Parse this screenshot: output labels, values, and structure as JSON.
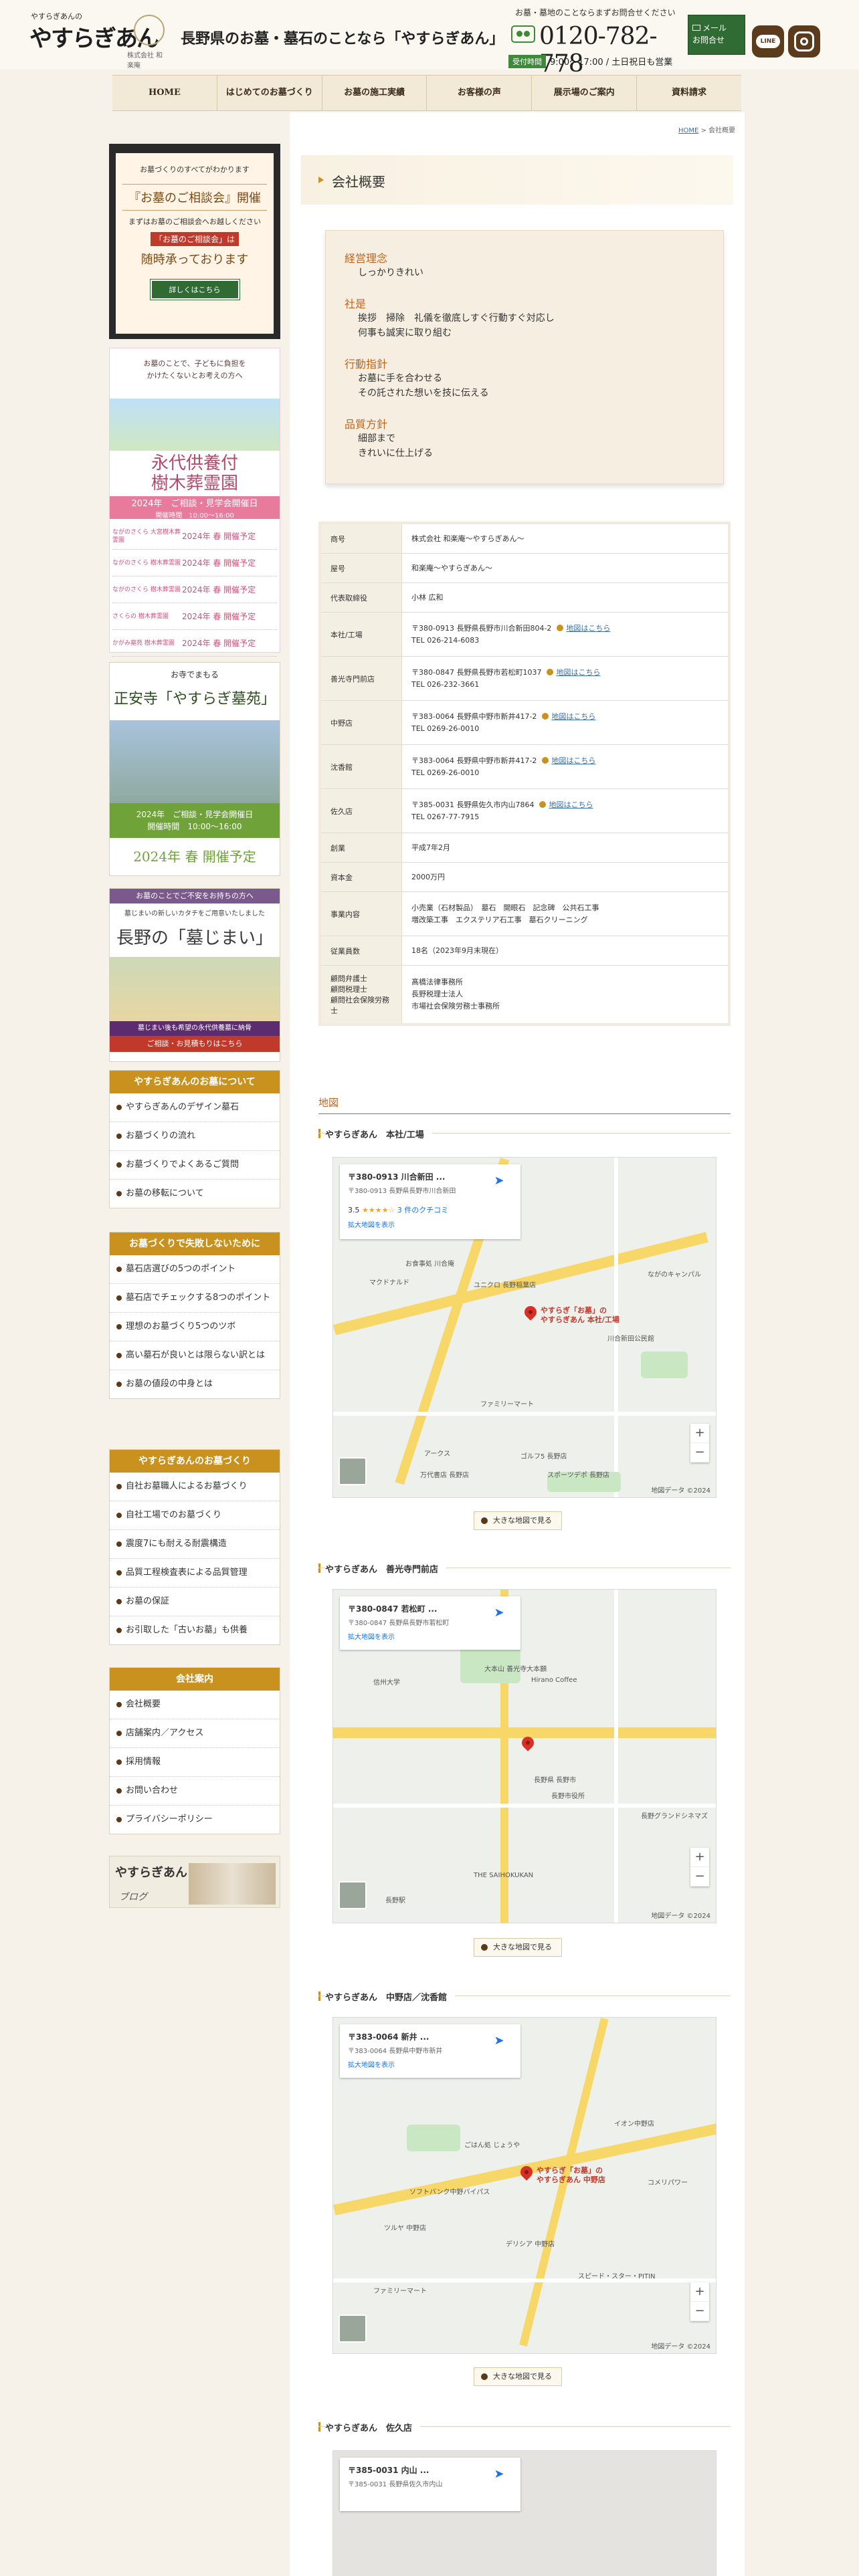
{
  "header": {
    "logo_small": "やすらぎあんの",
    "logo_main": "やすらぎあん",
    "logo_sub": "株式会社 和楽庵",
    "tagline": "長野県のお墓・墓石のことなら「やすらぎあん」",
    "tel_note": "お墓・墓地のことならまずお問合せください",
    "tel_number": "0120-782-778",
    "tel_badge": "受付時間",
    "tel_hours": "9:00〜17:00 / 土日祝日も営業",
    "mail_line1": "メール",
    "mail_line2": "お問合せ",
    "line_label": "LINE"
  },
  "nav": [
    "HOME",
    "はじめてのお墓づくり",
    "お墓の施工実績",
    "お客様の声",
    "展示場のご案内",
    "資料請求"
  ],
  "breadcrumb": {
    "home": "HOME",
    "sep": ">",
    "current": "会社概要"
  },
  "sidebar": {
    "banner1": {
      "line1": "お墓づくりのすべてがわかります",
      "title": "『お墓のご相談会』開催",
      "line2": "まずはお墓のご相談会へお越しください",
      "line3": "「お墓のご相談会」は",
      "line4": "随時承っております",
      "button": "詳しくはこちら"
    },
    "banner2": {
      "top1": "お墓のことで、子どもに負担を",
      "top2": "かけたくないとお考えの方へ",
      "title1": "永代供養付",
      "title2": "樹木葬霊園",
      "band": "2024年　ご相談・見学会開催日",
      "band_sub": "開催時間　10:00〜16:00",
      "rows": [
        {
          "name": "ながのさくら 大宮樹木葬霊園",
          "when": "2024年 春 開催予定"
        },
        {
          "name": "ながのさくら 樹木葬霊園",
          "when": "2024年 春 開催予定"
        },
        {
          "name": "ながのさくら 樹木葬霊園",
          "when": "2024年 春 開催予定"
        },
        {
          "name": "さくらの 樹木葬霊園",
          "when": "2024年 春 開催予定"
        },
        {
          "name": "かがみ墓苑 樹木葬霊園",
          "when": "2024年 春 開催予定"
        }
      ]
    },
    "banner3": {
      "top": "お寺でまもる",
      "title": "正安寺「やすらぎ墓苑」",
      "band1": "2024年　ご相談・見学会開催日",
      "band2": "開催時間　10:00〜16:00",
      "foot": "2024年 春 開催予定"
    },
    "banner4": {
      "top": "お墓のことでご不安をお持ちの方へ",
      "sub": "墓じまいの新しいカタチをご用意いたしました",
      "title": "長野の「墓じまい」",
      "band": "墓じまい後も希望の永代供養墓に納骨",
      "foot": "ご相談・お見積もりはこちら"
    },
    "menus": [
      {
        "title": "やすらぎあんのお墓について",
        "items": [
          "やすらぎあんのデザイン墓石",
          "お墓づくりの流れ",
          "お墓づくりでよくあるご質問",
          "お墓の移転について"
        ]
      },
      {
        "title": "お墓づくりで失敗しないために",
        "items": [
          "墓石店選びの5つのポイント",
          "墓石店でチェックする8つのポイント",
          "理想のお墓づくり5つのツボ",
          "高い墓石が良いとは限らない訳とは",
          "お墓の値段の中身とは"
        ]
      },
      {
        "title": "やすらぎあんのお墓づくり",
        "items": [
          "自社お墓職人によるお墓づくり",
          "自社工場でのお墓づくり",
          "震度7にも耐える耐震構造",
          "品質工程検査表による品質管理",
          "お墓の保証",
          "お引取した「古いお墓」も供養"
        ]
      },
      {
        "title": "会社案内",
        "items": [
          "会社概要",
          "店舗案内／アクセス",
          "採用情報",
          "お問い合わせ",
          "プライバシーポリシー"
        ]
      }
    ],
    "blog": {
      "logo": "やすらぎあん",
      "label": "ブログ"
    }
  },
  "page_title": "会社概要",
  "philosophy": [
    {
      "heading": "経営理念",
      "lines": [
        "しっかりきれい"
      ]
    },
    {
      "heading": "社是",
      "lines": [
        "挨拶　掃除　礼儀を徹底しすぐ行動すぐ対応し",
        "何事も誠実に取り組む"
      ]
    },
    {
      "heading": "行動指針",
      "lines": [
        "お墓に手を合わせる",
        "その託された想いを技に伝える"
      ]
    },
    {
      "heading": "品質方針",
      "lines": [
        "細部まで",
        "きれいに仕上げる"
      ]
    }
  ],
  "company_table": [
    {
      "label": "商号",
      "lines": [
        "株式会社 和楽庵〜やすらぎあん〜"
      ]
    },
    {
      "label": "屋号",
      "lines": [
        "和楽庵〜やすらぎあん〜"
      ]
    },
    {
      "label": "代表取締役",
      "lines": [
        "小林 広和"
      ]
    },
    {
      "label": "本社/工場",
      "lines": [
        "〒380-0913 長野県長野市川合新田804-2",
        "TEL 026-214-6083"
      ],
      "map": "地図はこちら"
    },
    {
      "label": "善光寺門前店",
      "lines": [
        "〒380-0847 長野県長野市若松町1037",
        "TEL 026-232-3661"
      ],
      "map": "地図はこちら"
    },
    {
      "label": "中野店",
      "lines": [
        "〒383-0064 長野県中野市新井417-2",
        "TEL 0269-26-0010"
      ],
      "map": "地図はこちら"
    },
    {
      "label": "沈香館",
      "lines": [
        "〒383-0064 長野県中野市新井417-2",
        "TEL 0269-26-0010"
      ],
      "map": "地図はこちら"
    },
    {
      "label": "佐久店",
      "lines": [
        "〒385-0031 長野県佐久市内山7864",
        "TEL 0267-77-7915"
      ],
      "map": "地図はこちら"
    },
    {
      "label": "創業",
      "lines": [
        "平成7年2月"
      ]
    },
    {
      "label": "資本金",
      "lines": [
        "2000万円"
      ]
    },
    {
      "label": "事業内容",
      "lines": [
        "小売業（石材製品）　墓石　開眼石　記念碑　公共石工事",
        "増改築工事　エクステリア石工事　墓石クリーニング"
      ]
    },
    {
      "label": "従業員数",
      "lines": [
        "18名（2023年9月末現在）"
      ]
    },
    {
      "label": "顧問弁護士\n顧問税理士\n顧問社会保険労務士",
      "lines": [
        "髙橋法律事務所",
        "長野税理士法人",
        "市場社会保険労務士事務所"
      ]
    }
  ],
  "map_section_title": "地図",
  "maps": [
    {
      "name": "やすらぎあん　本社/工場",
      "info_title": "〒380-0913 川合新田 ...",
      "info_addr": "〒380-0913 長野県長野市川合新田",
      "rating": "3.5",
      "stars": "★★★★☆",
      "reviews": "3 件のクチコミ",
      "link": "拡大地図を表示",
      "pin_label1": "やすらぎ「お墓」の",
      "pin_label2": "やすらぎあん 本社/工場",
      "map_labels": [
        "ながのキャンパル",
        "マクドナルド",
        "お食事処 川合庵",
        "ユニクロ 長野稲葉店",
        "ファミリーマート",
        "アークス",
        "ゴルフ5 長野店",
        "万代書店 長野店",
        "スポーツデポ 長野店",
        "川合新田公民館"
      ],
      "big_link": "大きな地図で見る",
      "copyright": "地図データ ©2024"
    },
    {
      "name": "やすらぎあん　善光寺門前店",
      "info_title": "〒380-0847 若松町 ...",
      "info_addr": "〒380-0847 長野県長野市若松町",
      "link": "拡大地図を表示",
      "map_labels": [
        "信州大学",
        "Hirano Coffee",
        "大本山 善光寺大本願",
        "長野県 長野市",
        "長野市役所",
        "THE SAIHOKUKAN",
        "長野駅",
        "長野グランドシネマズ"
      ],
      "big_link": "大きな地図で見る",
      "copyright": "地図データ ©2024"
    },
    {
      "name": "やすらぎあん　中野店／沈香館",
      "info_title": "〒383-0064 新井 ...",
      "info_addr": "〒383-0064 長野県中野市新井",
      "link": "拡大地図を表示",
      "pin_label1": "やすらぎ「お墓」の",
      "pin_label2": "やすらぎあん 中野店",
      "map_labels": [
        "イオン中野店",
        "ごはん処 じょうや",
        "ソフトバンク中野バイパス",
        "ツルヤ 中野店",
        "デリシア 中野店",
        "ファミリーマート",
        "スピード・スター・PITIN",
        "コメリパワー"
      ],
      "big_link": "大きな地図で見る",
      "copyright": "地図データ ©2024"
    },
    {
      "name": "やすらぎあん　佐久店",
      "info_title": "〒385-0031 内山 ...",
      "info_addr": "〒385-0031 長野県佐久市内山"
    }
  ]
}
